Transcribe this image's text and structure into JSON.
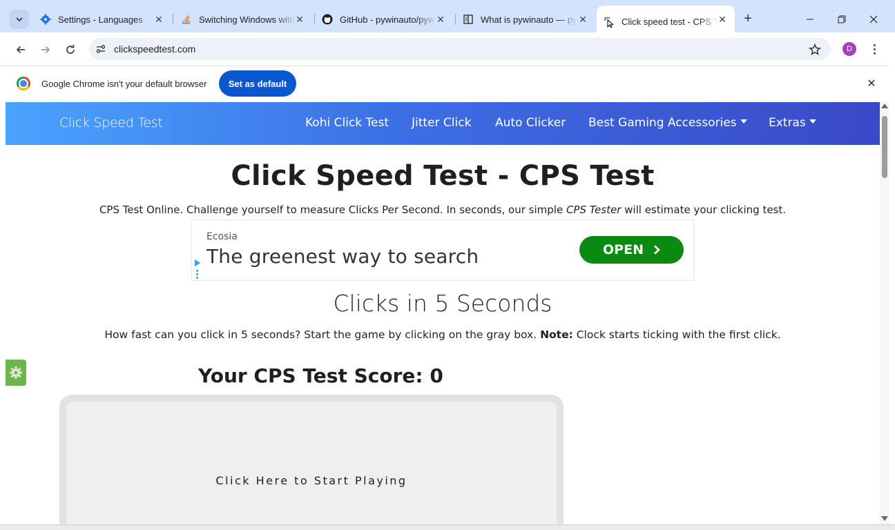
{
  "browser": {
    "tabs": [
      {
        "title": "Settings - Languages",
        "icon": "gear-icon"
      },
      {
        "title": "Switching Windows with",
        "icon": "stackoverflow-icon"
      },
      {
        "title": "GitHub - pywinauto/pyw",
        "icon": "github-icon"
      },
      {
        "title": "What is pywinauto — py",
        "icon": "book-icon"
      },
      {
        "title": "Click speed test - CPS Te",
        "icon": "cursor-click-icon",
        "active": true
      }
    ],
    "address": "clickspeedtest.com",
    "profile_initial": "D",
    "infobar": {
      "message": "Google Chrome isn't your default browser",
      "button": "Set as default"
    }
  },
  "site": {
    "brand": "Click Speed Test",
    "nav": [
      {
        "label": "Kohi Click Test"
      },
      {
        "label": "Jitter Click"
      },
      {
        "label": "Auto Clicker"
      },
      {
        "label": "Best Gaming Accessories",
        "dropdown": true
      },
      {
        "label": "Extras",
        "dropdown": true
      }
    ],
    "title": "Click Speed Test - CPS Test",
    "lead_part1": "CPS Test Online. Challenge yourself to measure Clicks Per Second. In seconds, our simple ",
    "lead_em": "CPS Tester",
    "lead_part2": " will estimate your clicking test.",
    "ad": {
      "brand": "Ecosia",
      "headline": "The greenest way to search",
      "button": "OPEN"
    },
    "section_title": "Clicks in 5 Seconds",
    "desc_part1": "How fast can you click in 5 seconds? Start the game by clicking on the gray box. ",
    "desc_bold": "Note:",
    "desc_part2": " Clock starts ticking with the first click.",
    "score_label": "Your CPS Test Score: 0",
    "click_prompt": "Click Here to Start Playing"
  },
  "colors": {
    "tabstrip": "#d3e3fd",
    "nav_gradient_start": "#4aa3ff",
    "nav_gradient_end": "#3a49c8",
    "ad_button": "#0a8a11",
    "set_default_button": "#0b57d0"
  }
}
